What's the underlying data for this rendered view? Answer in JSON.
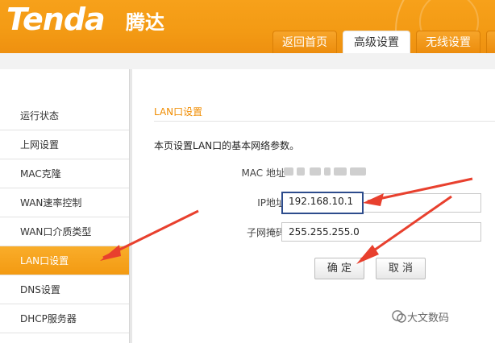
{
  "brand": {
    "logo_text": "Tenda",
    "logo_cn": "腾达"
  },
  "tabs": [
    {
      "label": "返回首页",
      "active": false
    },
    {
      "label": "高级设置",
      "active": true
    },
    {
      "label": "无线设置",
      "active": false
    }
  ],
  "sidebar": {
    "items": [
      {
        "label": "运行状态",
        "active": false
      },
      {
        "label": "上网设置",
        "active": false
      },
      {
        "label": "MAC克隆",
        "active": false
      },
      {
        "label": "WAN速率控制",
        "active": false
      },
      {
        "label": "WAN口介质类型",
        "active": false
      },
      {
        "label": "LAN口设置",
        "active": true
      },
      {
        "label": "DNS设置",
        "active": false
      },
      {
        "label": "DHCP服务器",
        "active": false
      }
    ]
  },
  "main": {
    "section_title": "LAN口设置",
    "description": "本页设置LAN口的基本网络参数。",
    "fields": {
      "mac_label": "MAC 地址",
      "ip_label": "IP地址",
      "ip_value": "192.168.10.1",
      "mask_label": "子网掩码",
      "mask_value": "255.255.255.0"
    },
    "buttons": {
      "confirm": "确 定",
      "cancel": "取 消"
    }
  },
  "watermark": {
    "text": "大文数码"
  },
  "colors": {
    "accent_orange": "#f39a14",
    "annotation_red": "#e8402e",
    "focus_border": "#2d4c8c"
  }
}
